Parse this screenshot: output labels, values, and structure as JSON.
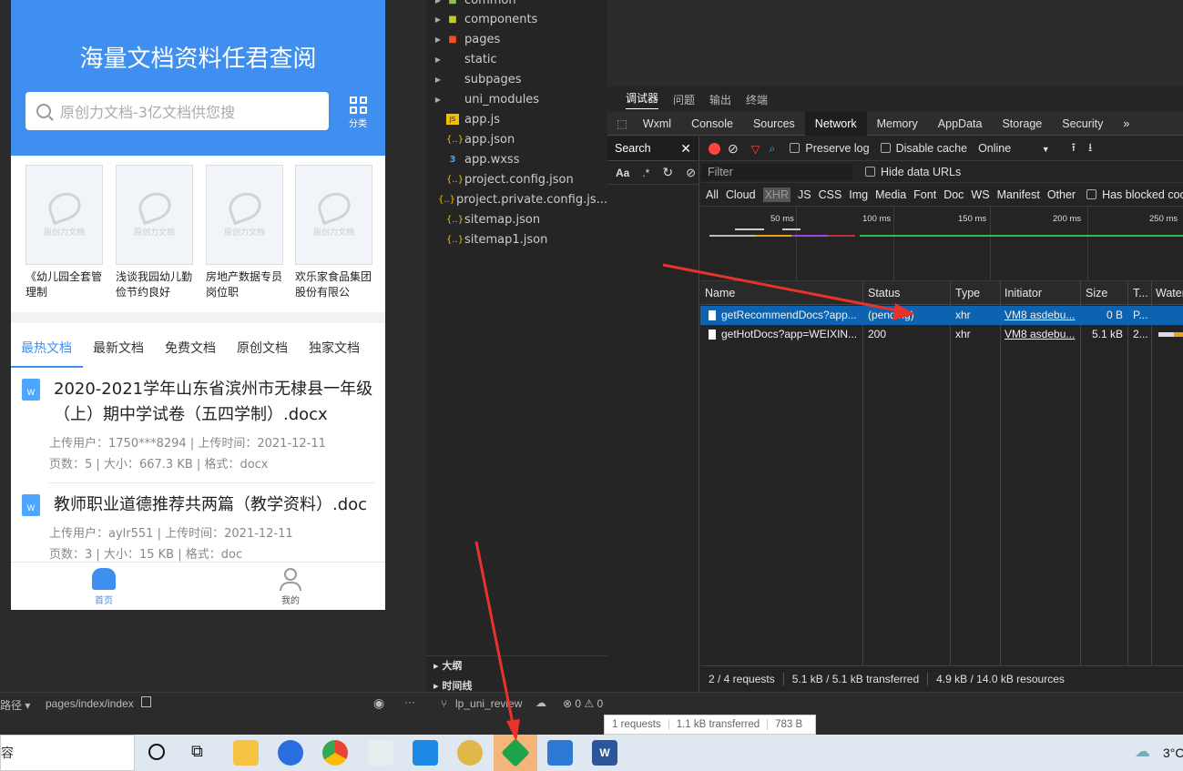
{
  "phone": {
    "hero_title": "海量文档资料任君查阅",
    "search_placeholder": "原创力文档-3亿文档供您搜",
    "category_label": "分类",
    "cards": [
      {
        "thumb": "原创力文档",
        "title": "《幼儿园全套管理制"
      },
      {
        "thumb": "原创力文档",
        "title": "浅谈我园幼儿勤俭节约良好"
      },
      {
        "thumb": "原创力文档",
        "title": "房地产数据专员岗位职"
      },
      {
        "thumb": "原创力文档",
        "title": "欢乐家食品集团股份有限公"
      }
    ],
    "tabs": [
      "最热文档",
      "最新文档",
      "免费文档",
      "原创文档",
      "独家文档"
    ],
    "docs": [
      {
        "icon": "W",
        "title": "2020-2021学年山东省滨州市无棣县一年级（上）期中学试卷（五四学制）.docx",
        "user_label": "上传用户：",
        "user": "1750***8294",
        "time_label": "上传时间：",
        "time": "2021-12-11",
        "pages_label": "页数：",
        "pages": "5",
        "size_label": "大小：",
        "size": "667.3 KB",
        "format_label": "格式：",
        "format": "docx"
      },
      {
        "icon": "W",
        "title": "教师职业道德推荐共两篇（教学资料）.doc",
        "user_label": "上传用户：",
        "user": "aylr551",
        "time_label": "上传时间：",
        "time": "2021-12-11",
        "pages_label": "页数：",
        "pages": "3",
        "size_label": "大小：",
        "size": "15 KB",
        "format_label": "格式：",
        "format": "doc"
      }
    ],
    "tabbar": {
      "home": "首页",
      "mine": "我的"
    }
  },
  "tree": {
    "folders": [
      "common",
      "components",
      "pages",
      "static",
      "subpages",
      "uni_modules"
    ],
    "files": [
      {
        "name": "app.js",
        "icon": "JS"
      },
      {
        "name": "app.json",
        "icon": "{..}"
      },
      {
        "name": "app.wxss",
        "icon": "3"
      },
      {
        "name": "project.config.json",
        "icon": "{..}"
      },
      {
        "name": "project.private.config.js...",
        "icon": "{..}"
      },
      {
        "name": "sitemap.json",
        "icon": "{..}"
      },
      {
        "name": "sitemap1.json",
        "icon": "{..}"
      }
    ],
    "outline": "大纲",
    "timeline": "时间线"
  },
  "devtools": {
    "top_tabs": [
      "调试器",
      "问题",
      "输出",
      "终端"
    ],
    "tabs": [
      "Wxml",
      "Console",
      "Sources",
      "Network",
      "Memory",
      "AppData",
      "Storage",
      "Security",
      "»"
    ],
    "search_title": "Search",
    "search_opts": [
      "Aa",
      ".*"
    ],
    "toolbar": {
      "preserve_log": "Preserve log",
      "disable_cache": "Disable cache",
      "throttle": "Online"
    },
    "filter_placeholder": "Filter",
    "hide_data_urls": "Hide data URLs",
    "types": [
      "All",
      "Cloud",
      "XHR",
      "JS",
      "CSS",
      "Img",
      "Media",
      "Font",
      "Doc",
      "WS",
      "Manifest",
      "Other"
    ],
    "has_blocked": "Has blocked coo",
    "ticks": [
      "50 ms",
      "100 ms",
      "150 ms",
      "200 ms",
      "250 ms"
    ],
    "columns": [
      "Name",
      "Status",
      "Type",
      "Initiator",
      "Size",
      "T...",
      "Water"
    ],
    "rows": [
      {
        "name": "getRecommendDocs?app...",
        "status": "(pending)",
        "type": "xhr",
        "initiator": "VM8 asdebu...",
        "size": "0 B",
        "time": "P..."
      },
      {
        "name": "getHotDocs?app=WEIXIN...",
        "status": "200",
        "type": "xhr",
        "initiator": "VM8 asdebu...",
        "size": "5.1 kB",
        "time": "2..."
      }
    ],
    "status": [
      "2 / 4 requests",
      "5.1 kB / 5.1 kB transferred",
      "4.9 kB / 14.0 kB resources"
    ]
  },
  "under_status": [
    "1 requests",
    "1.1 kB transferred",
    "783 B"
  ],
  "statusbar": {
    "path_label": "路径",
    "path": "pages/index/index",
    "branch": "lp_uni_review",
    "problems": "⊗ 0 ⚠ 0"
  },
  "taskbar": {
    "search_text": "容",
    "temp": "3°C"
  },
  "colors": {
    "primary": "#3f8ff0",
    "selected_row": "#0e63b1",
    "arrow": "#e8322a"
  }
}
